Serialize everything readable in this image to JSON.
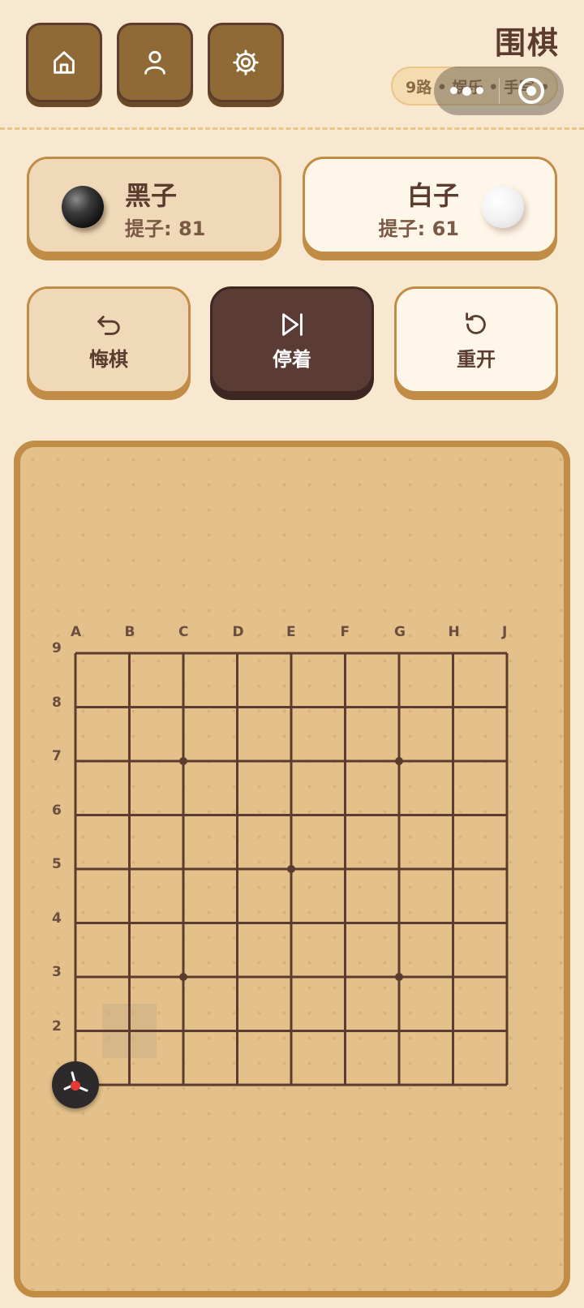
{
  "header": {
    "title": "围棋",
    "mode_label": "9路 • 娱乐 • 手写 •",
    "nav": [
      {
        "name": "home",
        "icon": "home-icon"
      },
      {
        "name": "profile",
        "icon": "user-icon"
      },
      {
        "name": "settings",
        "icon": "gear-icon"
      }
    ]
  },
  "players": {
    "black": {
      "name": "黑子",
      "captures_label": "提子: 81"
    },
    "white": {
      "name": "白子",
      "captures_label": "提子: 61"
    }
  },
  "actions": {
    "undo_label": "悔棋",
    "pass_label": "停着",
    "reset_label": "重开"
  },
  "board": {
    "size": 9,
    "columns": [
      "A",
      "B",
      "C",
      "D",
      "E",
      "F",
      "G",
      "H",
      "J"
    ],
    "rows": [
      "9",
      "8",
      "7",
      "6",
      "5",
      "4",
      "3",
      "2"
    ],
    "star_points": [
      "C7",
      "G7",
      "E5",
      "C3",
      "G3"
    ],
    "highlighted_point": "B2",
    "colors": {
      "line": "#5b3c2f",
      "board": "#e4c18a",
      "frame": "#c18c45"
    }
  }
}
